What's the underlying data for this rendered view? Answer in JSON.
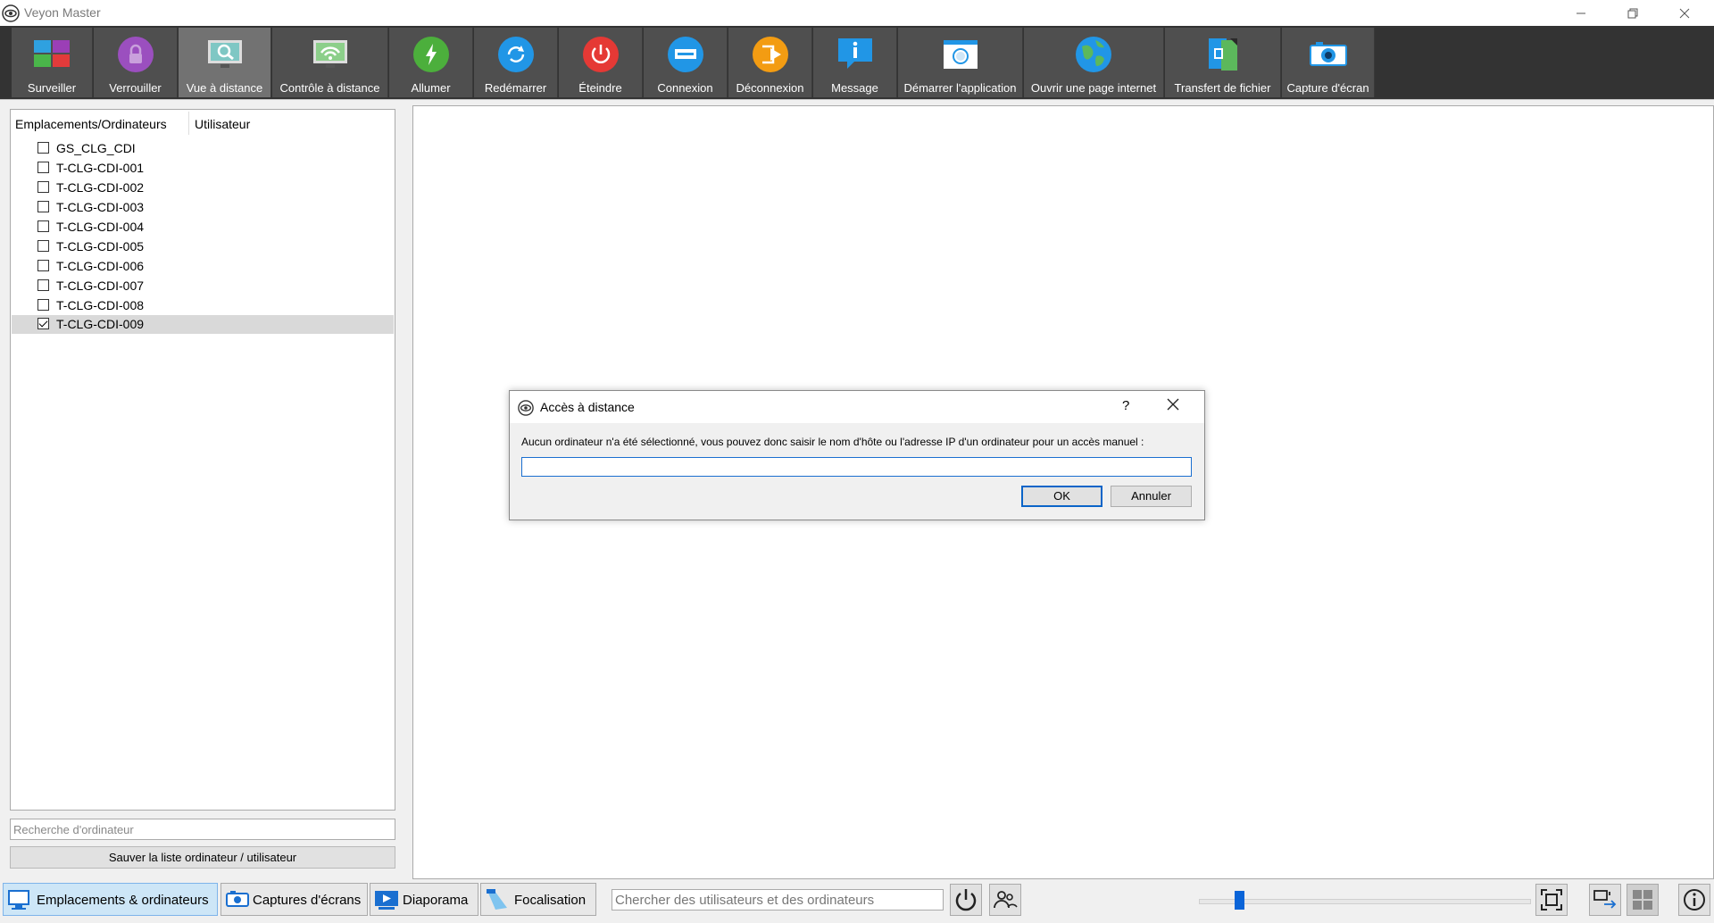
{
  "window": {
    "title": "Veyon Master",
    "controls": [
      "minimize-icon",
      "restore-icon",
      "close-icon"
    ]
  },
  "toolbar": {
    "buttons": [
      {
        "label": "Surveiller",
        "icon": "monitor-tiles-icon"
      },
      {
        "label": "Verrouiller",
        "icon": "lock-icon"
      },
      {
        "label": "Vue à distance",
        "icon": "remote-view-icon",
        "active": true
      },
      {
        "label": "Contrôle à distance",
        "icon": "remote-control-icon"
      },
      {
        "label": "Allumer",
        "icon": "power-on-icon"
      },
      {
        "label": "Redémarrer",
        "icon": "reboot-icon"
      },
      {
        "label": "Éteindre",
        "icon": "power-off-icon"
      },
      {
        "label": "Connexion",
        "icon": "login-icon"
      },
      {
        "label": "Déconnexion",
        "icon": "logout-icon"
      },
      {
        "label": "Message",
        "icon": "message-icon"
      },
      {
        "label": "Démarrer l'application",
        "icon": "start-app-icon"
      },
      {
        "label": "Ouvrir une page internet",
        "icon": "globe-icon"
      },
      {
        "label": "Transfert de fichier",
        "icon": "file-transfer-icon"
      },
      {
        "label": "Capture d'écran",
        "icon": "camera-icon"
      }
    ]
  },
  "leftpanel": {
    "columns": [
      "Emplacements/Ordinateurs",
      "Utilisateur"
    ],
    "items": [
      {
        "name": "GS_CLG_CDI",
        "checked": false
      },
      {
        "name": "T-CLG-CDI-001",
        "checked": false
      },
      {
        "name": "T-CLG-CDI-002",
        "checked": false
      },
      {
        "name": "T-CLG-CDI-003",
        "checked": false
      },
      {
        "name": "T-CLG-CDI-004",
        "checked": false
      },
      {
        "name": "T-CLG-CDI-005",
        "checked": false
      },
      {
        "name": "T-CLG-CDI-006",
        "checked": false
      },
      {
        "name": "T-CLG-CDI-007",
        "checked": false
      },
      {
        "name": "T-CLG-CDI-008",
        "checked": false
      },
      {
        "name": "T-CLG-CDI-009",
        "checked": true
      }
    ],
    "search_placeholder": "Recherche d'ordinateur",
    "save_label": "Sauver la liste ordinateur / utilisateur"
  },
  "dialog": {
    "title": "Accès à distance",
    "help": "?",
    "message": "Aucun ordinateur n'a été sélectionné, vous pouvez donc saisir le nom d'hôte ou l'adresse IP d'un ordinateur pour un accès manuel :",
    "input_value": "",
    "ok_label": "OK",
    "cancel_label": "Annuler"
  },
  "bottombar": {
    "tabs": [
      {
        "label": "Emplacements & ordinateurs",
        "icon": "computers-icon",
        "active": true
      },
      {
        "label": "Captures d'écrans",
        "icon": "screenshots-icon"
      },
      {
        "label": "Diaporama",
        "icon": "slideshow-icon"
      },
      {
        "label": "Focalisation",
        "icon": "spotlight-icon"
      }
    ],
    "search_placeholder": "Chercher des utilisateurs et des ordinateurs",
    "zoom_fraction": 0.11
  },
  "colors": {
    "toolbar_bg": "#333333",
    "button_bg": "#4f4f4f",
    "button_active_bg": "#727272",
    "accent": "#0a64d8"
  }
}
